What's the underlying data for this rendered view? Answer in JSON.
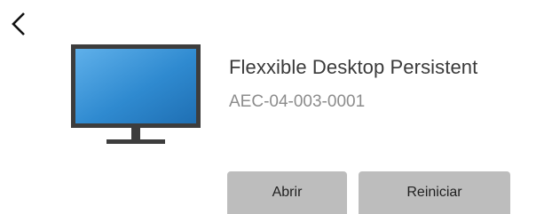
{
  "device": {
    "name": "Flexxible Desktop Persistent",
    "code": "AEC-04-003-0001",
    "icon": "monitor-icon"
  },
  "nav": {
    "back_icon": "chevron-left-icon"
  },
  "actions": {
    "open_label": "Abrir",
    "restart_label": "Reiniciar"
  },
  "colors": {
    "button_bg": "#bdbdbd",
    "screen_blue": "#2d86cc",
    "bezel": "#3d3d3d"
  }
}
